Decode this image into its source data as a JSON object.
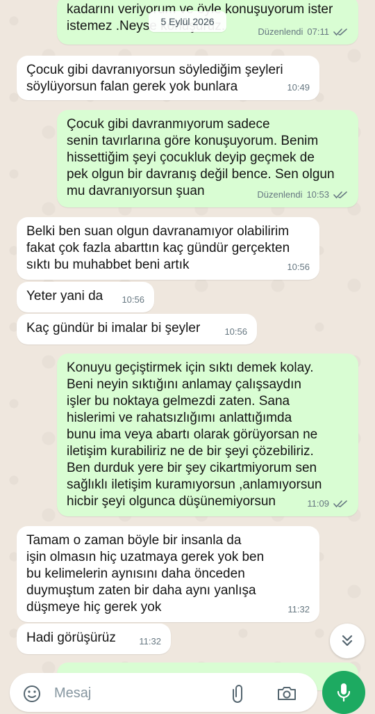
{
  "date_chip": "5 Eylül 2026",
  "messages": [
    {
      "dir": "out",
      "text": "kadarını veriyorum ve öyle konuşuyorum ister\nistemez .Neyse konuşuruz.",
      "edited": "Düzenlendi",
      "time": "07:11"
    },
    {
      "dir": "in",
      "text": "Çocuk gibi davranıyorsun söylediğim şeyleri\nsöylüyorsun falan gerek yok bunlara",
      "time": "10:49"
    },
    {
      "dir": "out",
      "text": "Çocuk gibi davranmıyorum sadece\nsenin tavırlarına göre konuşuyorum. Benim\nhissettiğim şeyi çocukluk deyip geçmek de\npek olgun bir davranış değil bence. Sen olgun\nmu davranıyorsun şuan",
      "edited": "Düzenlendi",
      "time": "10:53"
    },
    {
      "dir": "in",
      "text": "Belki ben suan olgun davranamıyor olabilirim\nfakat çok fazla abarttın kaç gündür gerçekten\nsıktı bu muhabbet beni artık",
      "time": "10:56"
    },
    {
      "dir": "in",
      "text": "Yeter yani da",
      "time": "10:56"
    },
    {
      "dir": "in",
      "text": "Kaç gündür bi imalar bi şeyler",
      "time": "10:56"
    },
    {
      "dir": "out",
      "text": "Konuyu geçiştirmek için sıktı demek kolay.\nBeni neyin sıktığını anlamay çalışsaydın\nişler bu noktaya gelmezdi zaten. Sana\nhislerimi ve rahatsızlığımı anlattığımda\nbunu ima veya abartı olarak görüyorsan ne\niletişim kurabiliriz ne de bir şeyi çözebiliriz.\nBen durduk yere bir şey cikartmiyorum sen\nsağlıklı iletişim kuramıyorsun ,anlamıyorsun\nhicbir şeyi olgunca düşünemiyorsun",
      "time": "11:09"
    },
    {
      "dir": "in",
      "text": "Tamam o zaman böyle bir insanla da\nişin olmasın hiç uzatmaya gerek yok ben\nbu kelimelerin aynısını daha önceden\nduymuştum zaten bir daha aynı yanlışa\ndüşmeye hiç gerek yok",
      "time": "11:32"
    },
    {
      "dir": "in",
      "text": "Hadi görüşürüz",
      "time": "11:32"
    }
  ],
  "input": {
    "placeholder": "Mesaj"
  },
  "icons": {
    "read_ticks": "double-check-icon",
    "scroll": "chevrons-down-icon",
    "emoji": "emoji-icon",
    "attach": "paperclip-icon",
    "camera": "camera-icon",
    "mic": "mic-icon"
  },
  "colors": {
    "outgoing": "#d9fdd3",
    "incoming": "#ffffff",
    "accent": "#1daa61",
    "ticks": "#53bdeb"
  }
}
